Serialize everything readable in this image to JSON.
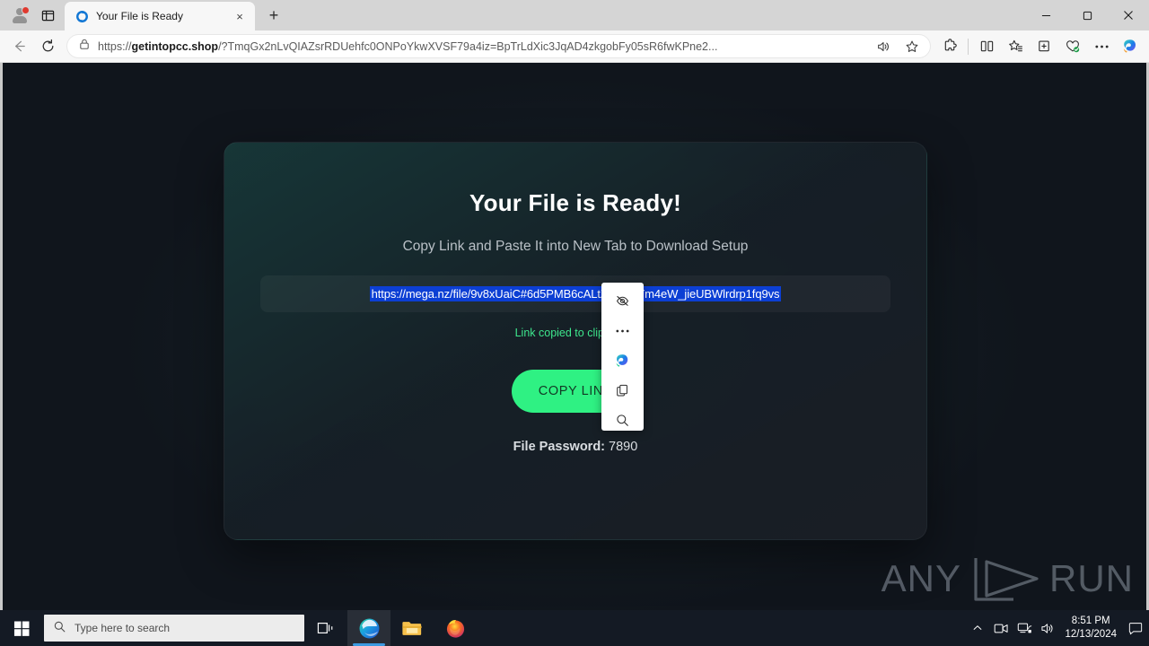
{
  "browser": {
    "tab": {
      "title": "Your File is Ready",
      "favicon": "sync-circle-icon",
      "close": "×"
    },
    "newtab_label": "+",
    "profile": {
      "name": "profile-avatar",
      "badge": true
    },
    "address": {
      "scheme": "https://",
      "domain": "getintopcc.shop",
      "path": "/?TmqGx2nLvQIAZsrRDUehfc0ONPoYkwXVSF79a4iz=BpTrLdXic3JqAD4zkgobFy05sR6fwKPne2...",
      "full": "https://getintopcc.shop/?TmqGx2nLvQIAZsrRDUehfc0ONPoYkwXVSF79a4iz=BpTrLdXic3JqAD4zkgobFy05sR6fwKPne2..."
    },
    "window_controls": {
      "minimize": "—",
      "maximize": "▢",
      "close": "✕"
    }
  },
  "page": {
    "headline": "Your File is Ready!",
    "subline": "Copy Link and Paste It into New Tab to Download Setup",
    "link": "https://mega.nz/file/9v8xUaiC#6d5PMB6cALtZDuzOYm4eW_jieUBWlrdrp1fq9vs",
    "copied_message": "Link copied to clipboard!",
    "copy_button": "COPY LINK",
    "password_label": "File Password:",
    "password_value": "7890",
    "accent_green": "#2ff183",
    "copied_green": "#3ee78d",
    "selection_blue": "#0c3fd4"
  },
  "selection_popup": {
    "items": [
      {
        "name": "hide-eye-icon",
        "label": "Hide"
      },
      {
        "name": "more-options-icon",
        "label": "More options"
      },
      {
        "name": "copilot-icon",
        "label": "Copilot"
      },
      {
        "name": "copy-icon",
        "label": "Copy"
      },
      {
        "name": "search-web-icon",
        "label": "Search the web"
      }
    ]
  },
  "watermark": {
    "text_left": "ANY",
    "text_right": "RUN"
  },
  "taskbar": {
    "search_placeholder": "Type here to search",
    "apps": [
      {
        "name": "taskbar-app-edge",
        "label": "Microsoft Edge",
        "active": true
      },
      {
        "name": "taskbar-app-file-explorer",
        "label": "File Explorer",
        "active": false
      },
      {
        "name": "taskbar-app-firefox",
        "label": "Mozilla Firefox",
        "active": false
      }
    ],
    "clock_time": "8:51 PM",
    "clock_date": "12/13/2024"
  }
}
